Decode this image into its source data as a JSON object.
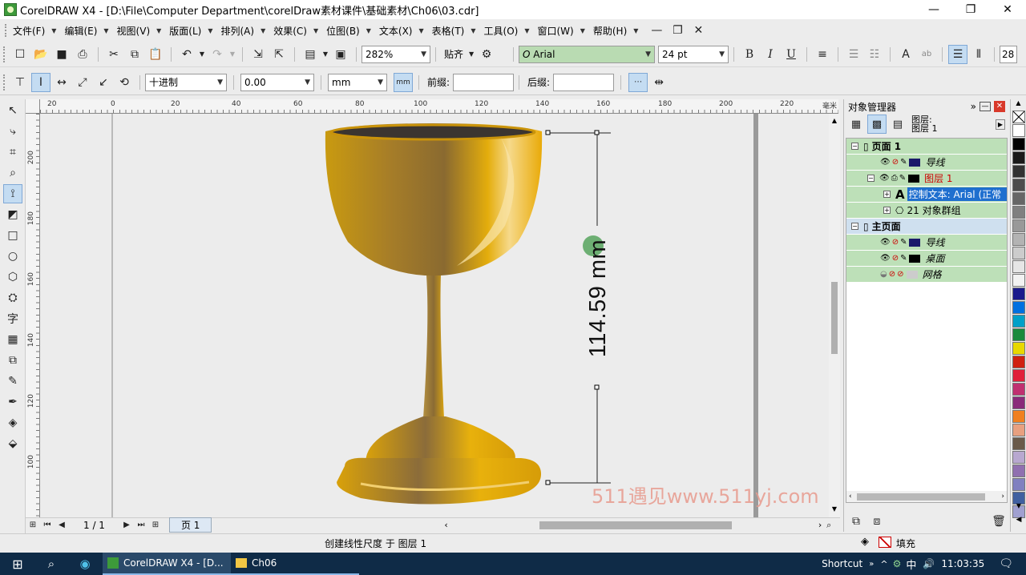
{
  "window": {
    "title": "CorelDRAW X4 - [D:\\File\\Computer Department\\corelDraw素材课件\\基础素材\\Ch06\\03.cdr]"
  },
  "menu": [
    "文件(F)",
    "编辑(E)",
    "视图(V)",
    "版面(L)",
    "排列(A)",
    "效果(C)",
    "位图(B)",
    "文本(X)",
    "表格(T)",
    "工具(O)",
    "窗口(W)",
    "帮助(H)"
  ],
  "toolbar": {
    "zoom": "282%",
    "snap": "贴齐",
    "font_name": "Arial",
    "font_size": "24 pt",
    "font_prefix": "O",
    "bold": "B",
    "italic": "I",
    "underline": "U",
    "right_cut": "28"
  },
  "propbar": {
    "units_style": "十进制",
    "precision": "0.00",
    "units": "mm",
    "prefix_label": "前缀:",
    "suffix_label": "后缀:",
    "prefix_value": "",
    "suffix_value": ""
  },
  "ruler": {
    "h": [
      "20",
      "0",
      "20",
      "40",
      "60",
      "80",
      "100",
      "120",
      "140",
      "160",
      "180",
      "200",
      "220"
    ],
    "h_unit": "毫米",
    "v": [
      "200",
      "180",
      "160",
      "140",
      "120",
      "100"
    ]
  },
  "canvas": {
    "dimension_text": "114.59 mm",
    "watermark": "511遇见www.511yj.com"
  },
  "page_nav": {
    "counter": "1 / 1",
    "page_tab": "页 1"
  },
  "status": {
    "message": "创建线性尺度 于 图层 1",
    "fill_label": "填充"
  },
  "docker": {
    "title": "对象管理器",
    "layer_label": "图层:",
    "layer_value": "图层 1",
    "tree": {
      "page1": "页面 1",
      "guides": "导线",
      "layer1": "图层 1",
      "control_text": "控制文本:  Arial (正常",
      "group": "21 对象群组",
      "master": "主页面",
      "master_guides": "导线",
      "desktop": "桌面",
      "grid": "网格"
    }
  },
  "palette": [
    "#ffffff",
    "#000000",
    "#1a1a1a",
    "#333333",
    "#4d4d4d",
    "#666666",
    "#808080",
    "#999999",
    "#b3b3b3",
    "#cccccc",
    "#e6e6e6",
    "#f2f2f2",
    "#1a1a8c",
    "#0070e0",
    "#00a0c8",
    "#1a8a3c",
    "#e8d800",
    "#d02010",
    "#e0203a",
    "#c03070",
    "#8a2a7a",
    "#f08020",
    "#e8a080",
    "#6a5a4a",
    "#b8a8d0",
    "#9070b0",
    "#8080c0",
    "#4060a0",
    "#a0a0d0"
  ],
  "taskbar": {
    "app1": "CorelDRAW X4 - [D...",
    "app2": "Ch06",
    "shortcut": "Shortcut",
    "ime": "中",
    "time": "11:03:35"
  }
}
